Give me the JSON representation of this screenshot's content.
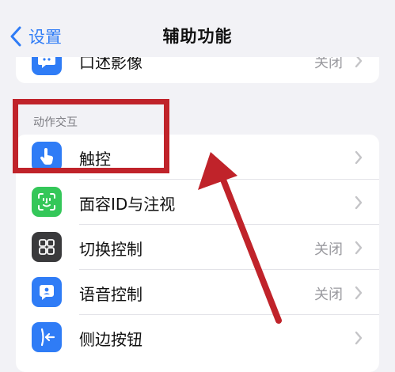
{
  "nav": {
    "back_label": "设置",
    "title": "辅助功能"
  },
  "top_row": {
    "label": "口述影像",
    "value": "关闭",
    "icon": "speech-bubble-icon",
    "icon_color": "#2f7cf6"
  },
  "section": {
    "header": "动作交互"
  },
  "rows": [
    {
      "label": "触控",
      "value": "",
      "icon": "hand-tap-icon",
      "icon_color": "#2f7cf6"
    },
    {
      "label": "面容ID与注视",
      "value": "",
      "icon": "face-id-icon",
      "icon_color": "#34c759"
    },
    {
      "label": "切换控制",
      "value": "关闭",
      "icon": "switch-grid-icon",
      "icon_color": "#3a3a3c"
    },
    {
      "label": "语音控制",
      "value": "关闭",
      "icon": "voice-control-icon",
      "icon_color": "#2f7cf6"
    },
    {
      "label": "侧边按钮",
      "value": "",
      "icon": "side-button-icon",
      "icon_color": "#2f7cf6"
    }
  ],
  "annotation": {
    "highlight_color": "#c0232a"
  }
}
